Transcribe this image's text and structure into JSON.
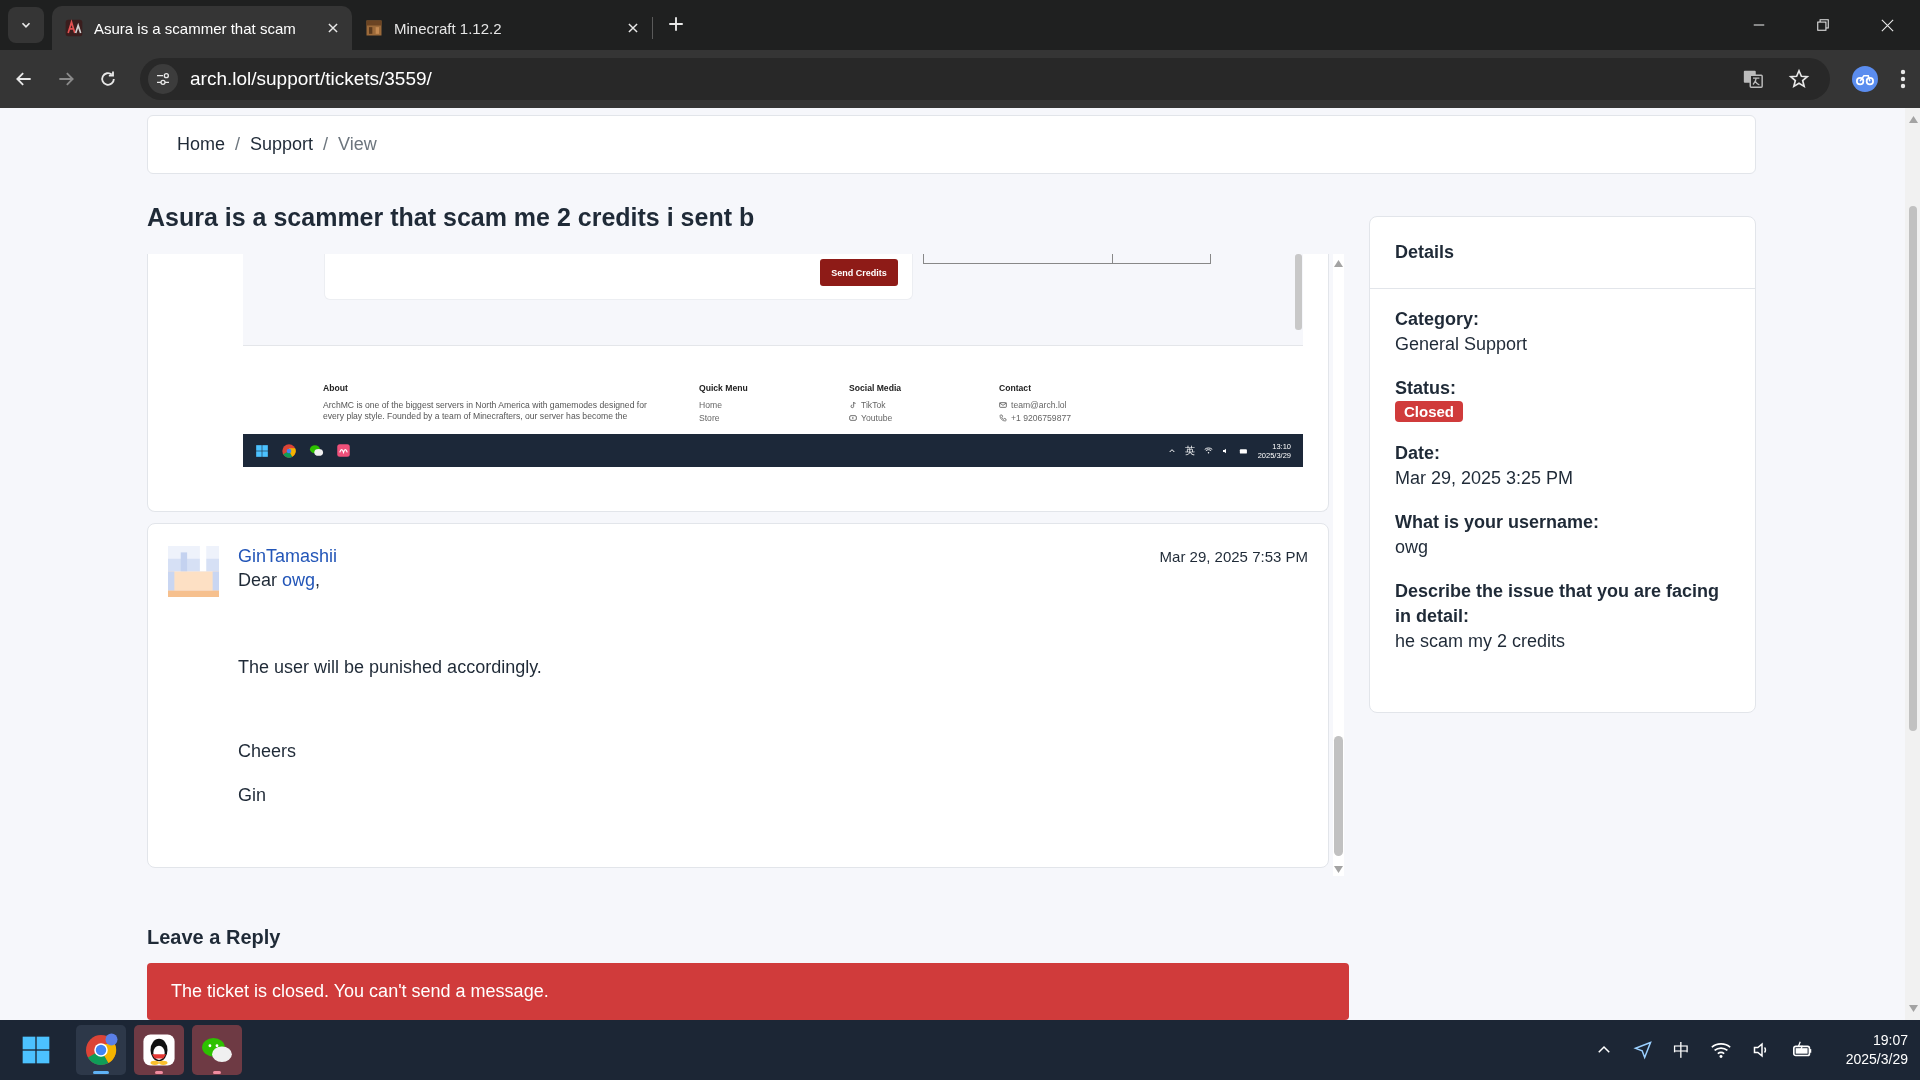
{
  "browser": {
    "tabs": [
      {
        "title": "Asura is a scammer that scam",
        "selected": true,
        "kind": "arch"
      },
      {
        "title": "Minecraft 1.12.2",
        "selected": false,
        "kind": "block"
      }
    ],
    "url": "arch.lol/support/tickets/3559/"
  },
  "breadcrumb": [
    {
      "label": "Home",
      "current": false
    },
    {
      "separator": "/",
      "label": "Support",
      "current": false
    },
    {
      "separator": "/",
      "label": "View",
      "current": true
    }
  ],
  "ticket_title": "Asura is a scammer that scam me 2 credits i sent b",
  "attachment": {
    "kind": "screenshot",
    "button": "Send Credits",
    "footer": [
      {
        "heading": "About",
        "text": "ArchMC is one of the biggest servers in North America with gamemodes designed for every play style. Founded by a team of Minecrafters, our server has become the"
      },
      {
        "heading": "Quick Menu",
        "links": [
          {
            "label": "Home"
          },
          {
            "label": "Store"
          }
        ]
      },
      {
        "heading": "Social Media",
        "links": [
          {
            "label": "TikTok",
            "kind": "tiktok"
          },
          {
            "label": "Youtube",
            "kind": "youtube"
          }
        ]
      },
      {
        "heading": "Contact",
        "links": [
          {
            "label": "team@arch.lol",
            "kind": "mail"
          },
          {
            "label": "+1 9206759877",
            "kind": "phone"
          }
        ]
      }
    ],
    "taskbar": {
      "ime": "英",
      "time": "13:10",
      "date": "2025/3/29"
    }
  },
  "message": {
    "author": "GinTamashii",
    "date": "Mar 29, 2025 7:53 PM",
    "greeting": "Dear",
    "mention": "owg",
    "greeting_end": ",",
    "paragraphs": [
      "The user will be punished accordingly.",
      "Cheers",
      "Gin"
    ]
  },
  "reply": {
    "heading": "Leave a Reply",
    "alert": "The ticket is closed. You can't send a message."
  },
  "details": {
    "title": "Details",
    "fields": [
      {
        "label": "Category:",
        "value": "General Support",
        "kind": "text"
      },
      {
        "label": "Status:",
        "value": "Closed",
        "kind": "badge"
      },
      {
        "label": "Date:",
        "value": "Mar 29, 2025 3:25 PM",
        "kind": "text"
      },
      {
        "label": "What is your username:",
        "value": "owg",
        "kind": "text"
      },
      {
        "label": "Describe the issue that you are facing in detail:",
        "value": "he scam my 2 credits",
        "kind": "text"
      }
    ]
  },
  "taskbar": {
    "apps": [
      {
        "kind": "chrome",
        "flashing": false
      },
      {
        "kind": "qq",
        "flashing": true
      },
      {
        "kind": "wechat",
        "flashing": true
      }
    ],
    "ime": "中",
    "time": "19:07",
    "date": "2025/3/29"
  }
}
